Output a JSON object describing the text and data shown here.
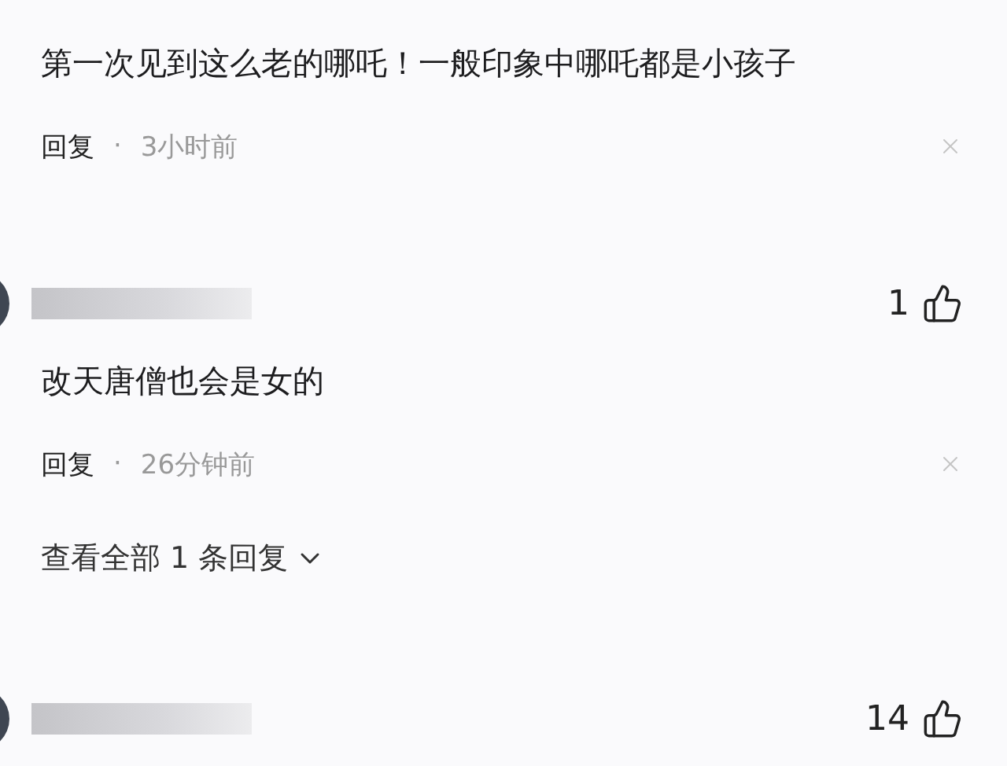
{
  "comments": [
    {
      "text": "第一次见到这么老的哪吒！一般印象中哪吒都是小孩子",
      "reply_label": "回复",
      "separator": "·",
      "time": "3小时前"
    },
    {
      "header": {
        "likes": "1"
      },
      "text": "改天唐僧也会是女的",
      "reply_label": "回复",
      "separator": "·",
      "time": "26分钟前",
      "view_replies": "查看全部 1 条回复"
    },
    {
      "header": {
        "likes": "14"
      }
    }
  ]
}
